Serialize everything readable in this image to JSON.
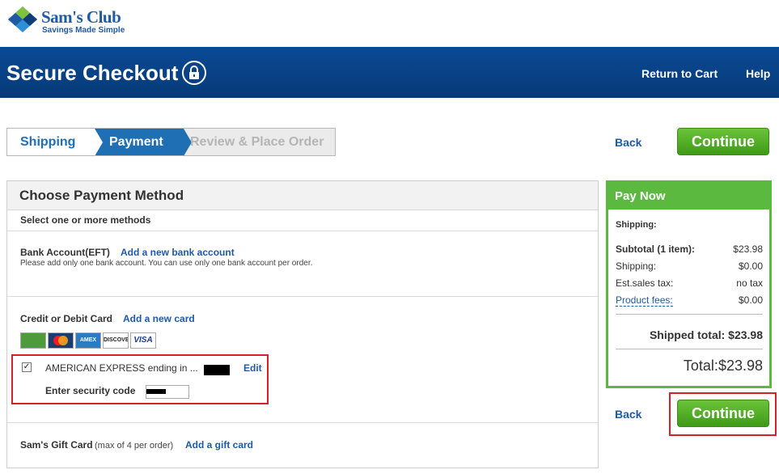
{
  "logo": {
    "brand": "Sam's Club",
    "tagline": "Savings Made Simple"
  },
  "header": {
    "title": "Secure Checkout",
    "return_to_cart": "Return to Cart",
    "help": "Help"
  },
  "steps": [
    "Shipping",
    "Payment",
    "Review & Place Order"
  ],
  "nav": {
    "back": "Back",
    "continue": "Continue"
  },
  "payment": {
    "title": "Choose Payment Method",
    "subtitle": "Select one or more methods",
    "bank": {
      "label": "Bank Account(EFT)",
      "link": "Add a new bank account",
      "note": "Please add only one bank account. You can use only one bank account per order."
    },
    "card": {
      "label": "Credit or Debit Card",
      "link": "Add a new card",
      "brands": [
        "Sam's Club",
        "MasterCard",
        "American Express",
        "Discover",
        "VISA"
      ],
      "saved": {
        "checked": "✓",
        "name": "AMERICAN EXPRESS  ending in ...",
        "edit": "Edit",
        "security_label": "Enter security code"
      }
    },
    "gift": {
      "label": "Sam's Gift Card",
      "note": "(max of 4 per order)",
      "link": "Add a gift card"
    }
  },
  "pay_now": {
    "title": "Pay Now",
    "shipping_label": "Shipping:",
    "rows": [
      {
        "label": "Subtotal (1  item):",
        "value": "$23.98"
      },
      {
        "label": "Shipping:",
        "value": "$0.00"
      },
      {
        "label": "Est.sales tax:",
        "value": "no tax"
      },
      {
        "label": "Product fees:",
        "value": "$0.00"
      }
    ],
    "shipped_total_label": "Shipped total:",
    "shipped_total_value": "$23.98",
    "total_label": "Total:",
    "total_value": "$23.98"
  },
  "colors": {
    "brand_blue": "#0b4a95",
    "accent_blue": "#1f6fb4",
    "green": "#5cb940",
    "red_highlight": "#d6202a"
  }
}
